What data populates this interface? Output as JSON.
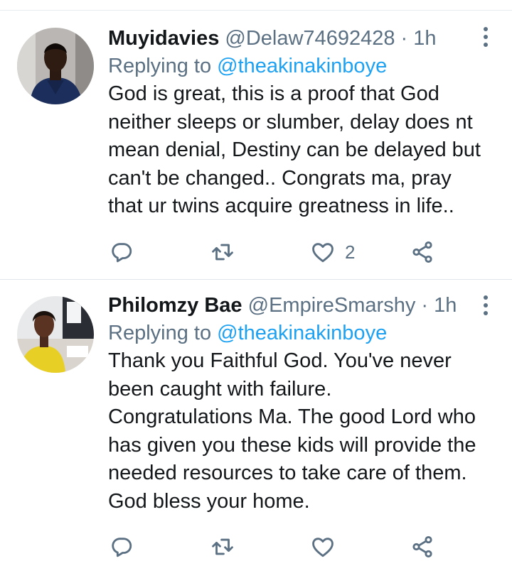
{
  "tweets": [
    {
      "display_name": "Muyidavies",
      "handle": "@Delaw74692428",
      "separator": "·",
      "time": "1h",
      "replying_prefix": "Replying to",
      "replying_to": "@theakinakinboye",
      "text_lines": [
        "God is great, this is a proof that God",
        "neither sleeps or slumber, delay does nt",
        "mean denial, Destiny can be delayed but",
        "can't be changed.. Congrats ma, pray",
        "that ur twins acquire greatness in life.."
      ],
      "like_count": "2"
    },
    {
      "display_name": "Philomzy Bae",
      "handle": "@EmpireSmarshy",
      "separator": "·",
      "time": "1h",
      "replying_prefix": "Replying to",
      "replying_to": "@theakinakinboye",
      "text_lines": [
        "Thank you Faithful God. You've never",
        "been caught with failure.",
        "Congratulations Ma. The good Lord who",
        "has given you these kids will provide the",
        "needed resources to take care of them.",
        "God bless your home."
      ],
      "like_count": ""
    }
  ],
  "icons": {
    "reply": "reply-icon",
    "retweet": "retweet-icon",
    "like": "heart-icon",
    "share": "share-icon",
    "more": "more-vertical-icon"
  },
  "colors": {
    "text": "#14171a",
    "secondary": "#5b7083",
    "link": "#1da1f2",
    "divider": "#dfe5ea"
  }
}
